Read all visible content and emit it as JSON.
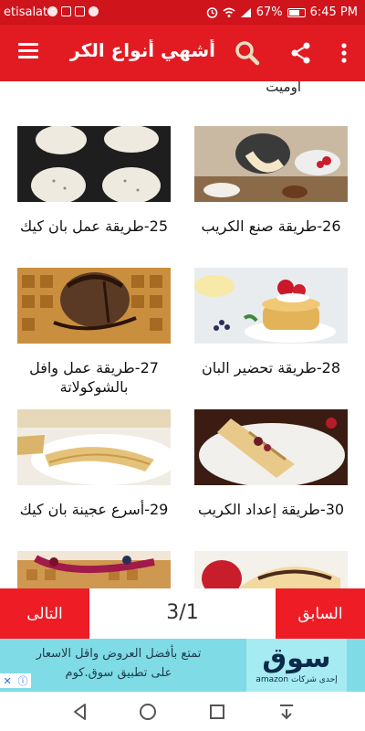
{
  "status_bar": {
    "carrier": "etisalat",
    "battery_percent": "67%",
    "time": "6:45 PM"
  },
  "app_bar": {
    "title": "أشهي أنواع الكري...",
    "icons": [
      "menu-icon",
      "search-icon",
      "share-icon",
      "more-vert-icon"
    ]
  },
  "content": {
    "top_cut_label": "أوميت",
    "cards": [
      {
        "label": "26-طريقة صنع الكريب",
        "image": "crepe-pan-photo"
      },
      {
        "label": "25-طريقة عمل بان كيك",
        "image": "pancakes-griddle-photo"
      },
      {
        "label": "28-طريقة تحضير البان",
        "image": "pancake-stack-berries-photo"
      },
      {
        "label": "27-طريقة عمل وافل بالشوكولاتة",
        "image": "waffle-icecream-photo"
      },
      {
        "label": "30-طريقة إعداد الكريب",
        "image": "crepe-roll-photo"
      },
      {
        "label": "29-أسرع عجينة بان كيك",
        "image": "folded-crepes-photo"
      }
    ]
  },
  "pager": {
    "prev_label": "السابق",
    "next_label": "التالى",
    "page_indicator": "3/1"
  },
  "ad": {
    "text_line1": "تمتع بأفضل العروض واقل الاسعار",
    "text_line2": "على تطبيق سوق.كوم",
    "brand_name": "سوق",
    "brand_sub": "إحدى شركات amazon"
  },
  "nav_bar": {
    "icons": [
      "back-icon",
      "home-icon",
      "recents-icon",
      "notification-icon"
    ]
  },
  "colors": {
    "status_bar": "#d0141c",
    "app_bar": "#e21b23",
    "pager_button": "#ee1c25",
    "ad_bg": "#7fdbe6"
  }
}
